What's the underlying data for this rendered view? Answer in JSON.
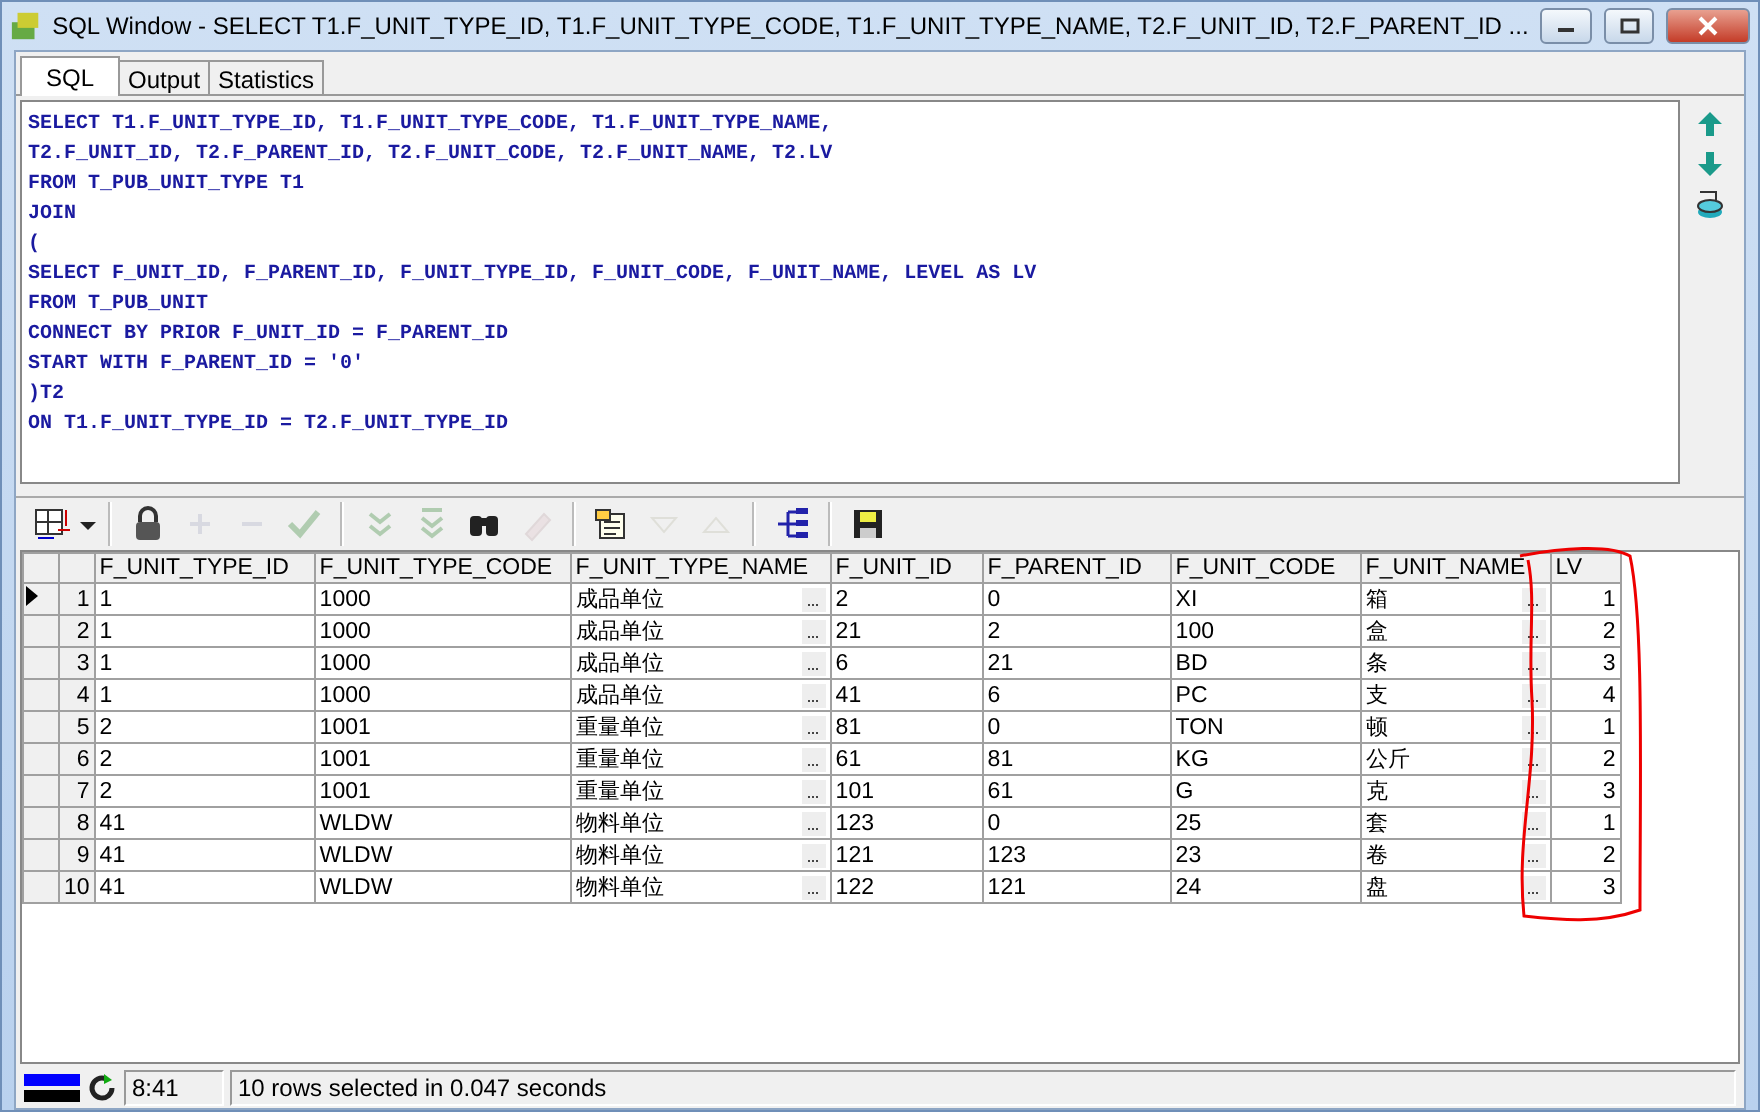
{
  "window": {
    "title": "SQL Window - SELECT T1.F_UNIT_TYPE_ID, T1.F_UNIT_TYPE_CODE, T1.F_UNIT_TYPE_NAME, T2.F_UNIT_ID, T2.F_PARENT_ID ..."
  },
  "tabs": [
    {
      "label": "SQL",
      "selected": true
    },
    {
      "label": "Output",
      "selected": false
    },
    {
      "label": "Statistics",
      "selected": false
    }
  ],
  "editor": {
    "lines": [
      "SELECT T1.F_UNIT_TYPE_ID, T1.F_UNIT_TYPE_CODE, T1.F_UNIT_TYPE_NAME,",
      "T2.F_UNIT_ID, T2.F_PARENT_ID, T2.F_UNIT_CODE, T2.F_UNIT_NAME, T2.LV",
      "FROM T_PUB_UNIT_TYPE T1",
      "JOIN",
      "(",
      "SELECT F_UNIT_ID, F_PARENT_ID, F_UNIT_TYPE_ID, F_UNIT_CODE, F_UNIT_NAME, LEVEL AS LV",
      "FROM T_PUB_UNIT",
      "CONNECT BY PRIOR F_UNIT_ID = F_PARENT_ID",
      "START WITH F_PARENT_ID = '0'",
      ")T2",
      "ON T1.F_UNIT_TYPE_ID = T2.F_UNIT_TYPE_ID"
    ]
  },
  "toolbar": [
    {
      "kind": "grid",
      "disabled": false
    },
    {
      "kind": "lock",
      "disabled": false
    },
    {
      "kind": "plus",
      "disabled": true
    },
    {
      "kind": "minus",
      "disabled": true
    },
    {
      "kind": "check",
      "disabled": true
    },
    {
      "kind": "fetch-next",
      "disabled": true
    },
    {
      "kind": "fetch-all",
      "disabled": true
    },
    {
      "kind": "find",
      "disabled": false
    },
    {
      "kind": "clear",
      "disabled": true
    },
    {
      "kind": "query",
      "disabled": false
    },
    {
      "kind": "down",
      "disabled": true
    },
    {
      "kind": "up",
      "disabled": true
    },
    {
      "kind": "tree",
      "disabled": false
    },
    {
      "kind": "save",
      "disabled": false
    }
  ],
  "table": {
    "columns": [
      {
        "label": "F_UNIT_TYPE_ID",
        "kind": "text"
      },
      {
        "label": "F_UNIT_TYPE_CODE",
        "kind": "text"
      },
      {
        "label": "F_UNIT_TYPE_NAME",
        "kind": "lookup"
      },
      {
        "label": "F_UNIT_ID",
        "kind": "text"
      },
      {
        "label": "F_PARENT_ID",
        "kind": "text"
      },
      {
        "label": "F_UNIT_CODE",
        "kind": "text"
      },
      {
        "label": "F_UNIT_NAME",
        "kind": "lookup"
      },
      {
        "label": "LV",
        "kind": "number"
      }
    ],
    "rows": [
      {
        "number": "1",
        "selected": true,
        "cells": [
          "1",
          "1000",
          "成品单位",
          "2",
          "0",
          "XI",
          "箱",
          "1"
        ]
      },
      {
        "number": "2",
        "selected": false,
        "cells": [
          "1",
          "1000",
          "成品单位",
          "21",
          "2",
          "100",
          "盒",
          "2"
        ]
      },
      {
        "number": "3",
        "selected": false,
        "cells": [
          "1",
          "1000",
          "成品单位",
          "6",
          "21",
          "BD",
          "条",
          "3"
        ]
      },
      {
        "number": "4",
        "selected": false,
        "cells": [
          "1",
          "1000",
          "成品单位",
          "41",
          "6",
          "PC",
          "支",
          "4"
        ]
      },
      {
        "number": "5",
        "selected": false,
        "cells": [
          "2",
          "1001",
          "重量单位",
          "81",
          "0",
          "TON",
          "顿",
          "1"
        ]
      },
      {
        "number": "6",
        "selected": false,
        "cells": [
          "2",
          "1001",
          "重量单位",
          "61",
          "81",
          "KG",
          "公斤",
          "2"
        ]
      },
      {
        "number": "7",
        "selected": false,
        "cells": [
          "2",
          "1001",
          "重量单位",
          "101",
          "61",
          "G",
          "克",
          "3"
        ]
      },
      {
        "number": "8",
        "selected": false,
        "cells": [
          "41",
          "WLDW",
          "物料单位",
          "123",
          "0",
          "25",
          "套",
          "1"
        ]
      },
      {
        "number": "9",
        "selected": false,
        "cells": [
          "41",
          "WLDW",
          "物料单位",
          "121",
          "123",
          "23",
          "卷",
          "2"
        ]
      },
      {
        "number": "10",
        "selected": false,
        "cells": [
          "41",
          "WLDW",
          "物料单位",
          "122",
          "121",
          "24",
          "盘",
          "3"
        ]
      }
    ]
  },
  "status_bar": {
    "time": "8:41",
    "message": "10 rows selected in 0.047 seconds"
  }
}
